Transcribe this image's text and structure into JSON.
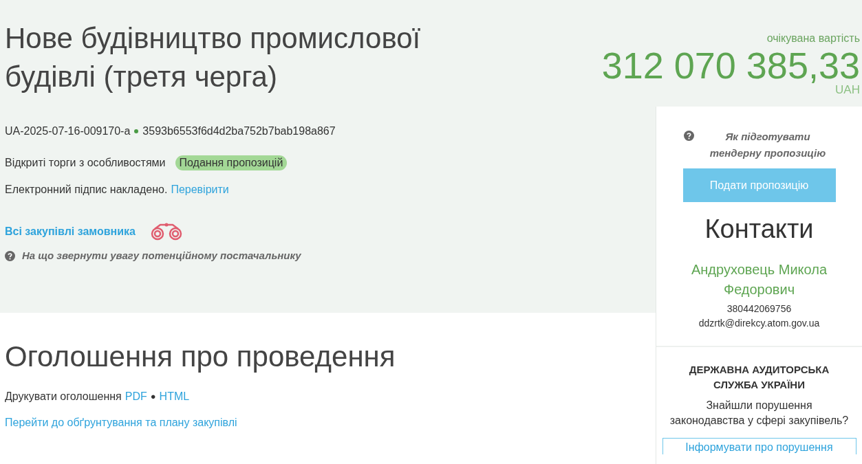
{
  "title": "Нове будівництво промислової будівлі (третя черга)",
  "expected_value": {
    "label": "очікувана вартість",
    "amount": "312 070 385,33",
    "currency": "UAH"
  },
  "tender_id": "UA-2025-07-16-009170-a",
  "hash": "3593b6553f6d4d2ba752b7bab198a867",
  "procedure": "Відкриті торги з особливостями",
  "status_badge": "Подання пропозицій",
  "signature": {
    "text": "Електронний підпис накладено.",
    "link": "Перевірити"
  },
  "customer_link": "Всі закупівлі замовника",
  "hint": "На що звернути увагу потенційному постачальнику",
  "announcement": {
    "heading": "Оголошення про проведення",
    "print_label": "Друкувати оголошення",
    "formats": [
      "PDF",
      "HTML"
    ],
    "separator": "●",
    "plan_link": "Перейти до обґрунтування та плану закупівлі"
  },
  "sidebar": {
    "help_link": "Як підготувати тендерну пропозицію",
    "submit_button": "Подати пропозицію",
    "contacts_heading": "Контакти",
    "contact_name": "Андруховець Микола Федорович",
    "phone": "380442069756",
    "email": "ddzrtk@direkcy.atom.gov.ua",
    "audit": {
      "heading": "ДЕРЖАВНА АУДИТОРСЬКА СЛУЖБА УКРАЇНИ",
      "question": "Знайшли порушення законодавства у сфері закупівель?",
      "button": "Інформувати про порушення"
    }
  }
}
